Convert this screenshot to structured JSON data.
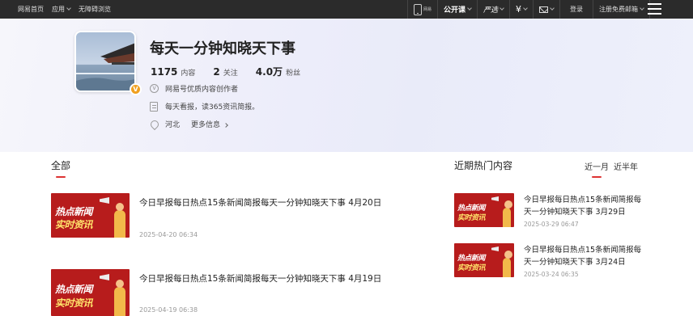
{
  "topbar": {
    "left_links": [
      "网易首页",
      "应用",
      "无障碍浏览"
    ],
    "phone_label": "网易",
    "open_course": "公开课",
    "yanxuan": "严选",
    "yen": "¥",
    "login": "登录",
    "register": "注册免费邮箱"
  },
  "profile": {
    "name": "每天一分钟知晓天下事",
    "v_badge": "V",
    "stats": [
      {
        "value": "1175",
        "unit": "内容"
      },
      {
        "value": "2",
        "unit": "关注"
      },
      {
        "value": "4.0万",
        "unit": "粉丝"
      }
    ],
    "certification_mark": "V",
    "certification": "网易号优质内容创作者",
    "description": "每天看报，读365资讯简报。",
    "location": "河北",
    "more_info": "更多信息"
  },
  "thumbnail_text": {
    "line1": "热点新闻",
    "line2": "实时资讯"
  },
  "main": {
    "section_title": "全部",
    "articles": [
      {
        "title": "今日早报每日热点15条新闻简报每天一分钟知晓天下事 4月20日",
        "date": "2025-04-20 06:34"
      },
      {
        "title": "今日早报每日热点15条新闻简报每天一分钟知晓天下事 4月19日",
        "date": "2025-04-19 06:38"
      }
    ]
  },
  "side": {
    "section_title": "近期热门内容",
    "tabs": [
      "近一月",
      "近半年"
    ],
    "active_tab": 0,
    "items": [
      {
        "title": "今日早报每日热点15条新闻简报每天一分钟知晓天下事 3月29日",
        "date": "2025-03-29 06:47"
      },
      {
        "title": "今日早报每日热点15条新闻简报每天一分钟知晓天下事 3月24日",
        "date": "2025-03-24 06:35"
      }
    ]
  },
  "colors": {
    "accent": "#d33333",
    "topbar": "#2b2b2b",
    "thumb": "#b71c1c"
  }
}
